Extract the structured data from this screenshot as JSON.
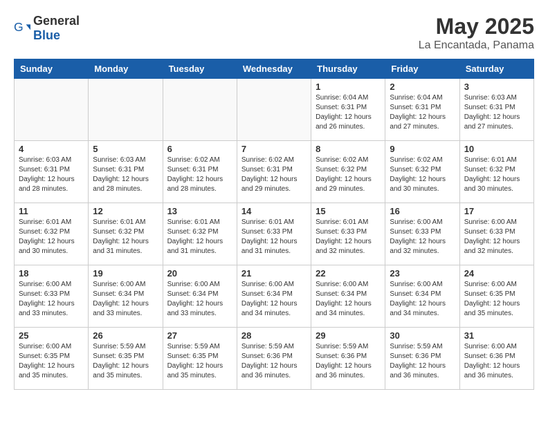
{
  "logo": {
    "general": "General",
    "blue": "Blue"
  },
  "title": {
    "month": "May 2025",
    "location": "La Encantada, Panama"
  },
  "days_of_week": [
    "Sunday",
    "Monday",
    "Tuesday",
    "Wednesday",
    "Thursday",
    "Friday",
    "Saturday"
  ],
  "weeks": [
    [
      {
        "day": "",
        "info": ""
      },
      {
        "day": "",
        "info": ""
      },
      {
        "day": "",
        "info": ""
      },
      {
        "day": "",
        "info": ""
      },
      {
        "day": "1",
        "info": "Sunrise: 6:04 AM\nSunset: 6:31 PM\nDaylight: 12 hours\nand 26 minutes."
      },
      {
        "day": "2",
        "info": "Sunrise: 6:04 AM\nSunset: 6:31 PM\nDaylight: 12 hours\nand 27 minutes."
      },
      {
        "day": "3",
        "info": "Sunrise: 6:03 AM\nSunset: 6:31 PM\nDaylight: 12 hours\nand 27 minutes."
      }
    ],
    [
      {
        "day": "4",
        "info": "Sunrise: 6:03 AM\nSunset: 6:31 PM\nDaylight: 12 hours\nand 28 minutes."
      },
      {
        "day": "5",
        "info": "Sunrise: 6:03 AM\nSunset: 6:31 PM\nDaylight: 12 hours\nand 28 minutes."
      },
      {
        "day": "6",
        "info": "Sunrise: 6:02 AM\nSunset: 6:31 PM\nDaylight: 12 hours\nand 28 minutes."
      },
      {
        "day": "7",
        "info": "Sunrise: 6:02 AM\nSunset: 6:31 PM\nDaylight: 12 hours\nand 29 minutes."
      },
      {
        "day": "8",
        "info": "Sunrise: 6:02 AM\nSunset: 6:32 PM\nDaylight: 12 hours\nand 29 minutes."
      },
      {
        "day": "9",
        "info": "Sunrise: 6:02 AM\nSunset: 6:32 PM\nDaylight: 12 hours\nand 30 minutes."
      },
      {
        "day": "10",
        "info": "Sunrise: 6:01 AM\nSunset: 6:32 PM\nDaylight: 12 hours\nand 30 minutes."
      }
    ],
    [
      {
        "day": "11",
        "info": "Sunrise: 6:01 AM\nSunset: 6:32 PM\nDaylight: 12 hours\nand 30 minutes."
      },
      {
        "day": "12",
        "info": "Sunrise: 6:01 AM\nSunset: 6:32 PM\nDaylight: 12 hours\nand 31 minutes."
      },
      {
        "day": "13",
        "info": "Sunrise: 6:01 AM\nSunset: 6:32 PM\nDaylight: 12 hours\nand 31 minutes."
      },
      {
        "day": "14",
        "info": "Sunrise: 6:01 AM\nSunset: 6:33 PM\nDaylight: 12 hours\nand 31 minutes."
      },
      {
        "day": "15",
        "info": "Sunrise: 6:01 AM\nSunset: 6:33 PM\nDaylight: 12 hours\nand 32 minutes."
      },
      {
        "day": "16",
        "info": "Sunrise: 6:00 AM\nSunset: 6:33 PM\nDaylight: 12 hours\nand 32 minutes."
      },
      {
        "day": "17",
        "info": "Sunrise: 6:00 AM\nSunset: 6:33 PM\nDaylight: 12 hours\nand 32 minutes."
      }
    ],
    [
      {
        "day": "18",
        "info": "Sunrise: 6:00 AM\nSunset: 6:33 PM\nDaylight: 12 hours\nand 33 minutes."
      },
      {
        "day": "19",
        "info": "Sunrise: 6:00 AM\nSunset: 6:34 PM\nDaylight: 12 hours\nand 33 minutes."
      },
      {
        "day": "20",
        "info": "Sunrise: 6:00 AM\nSunset: 6:34 PM\nDaylight: 12 hours\nand 33 minutes."
      },
      {
        "day": "21",
        "info": "Sunrise: 6:00 AM\nSunset: 6:34 PM\nDaylight: 12 hours\nand 34 minutes."
      },
      {
        "day": "22",
        "info": "Sunrise: 6:00 AM\nSunset: 6:34 PM\nDaylight: 12 hours\nand 34 minutes."
      },
      {
        "day": "23",
        "info": "Sunrise: 6:00 AM\nSunset: 6:34 PM\nDaylight: 12 hours\nand 34 minutes."
      },
      {
        "day": "24",
        "info": "Sunrise: 6:00 AM\nSunset: 6:35 PM\nDaylight: 12 hours\nand 35 minutes."
      }
    ],
    [
      {
        "day": "25",
        "info": "Sunrise: 6:00 AM\nSunset: 6:35 PM\nDaylight: 12 hours\nand 35 minutes."
      },
      {
        "day": "26",
        "info": "Sunrise: 5:59 AM\nSunset: 6:35 PM\nDaylight: 12 hours\nand 35 minutes."
      },
      {
        "day": "27",
        "info": "Sunrise: 5:59 AM\nSunset: 6:35 PM\nDaylight: 12 hours\nand 35 minutes."
      },
      {
        "day": "28",
        "info": "Sunrise: 5:59 AM\nSunset: 6:36 PM\nDaylight: 12 hours\nand 36 minutes."
      },
      {
        "day": "29",
        "info": "Sunrise: 5:59 AM\nSunset: 6:36 PM\nDaylight: 12 hours\nand 36 minutes."
      },
      {
        "day": "30",
        "info": "Sunrise: 5:59 AM\nSunset: 6:36 PM\nDaylight: 12 hours\nand 36 minutes."
      },
      {
        "day": "31",
        "info": "Sunrise: 6:00 AM\nSunset: 6:36 PM\nDaylight: 12 hours\nand 36 minutes."
      }
    ]
  ]
}
